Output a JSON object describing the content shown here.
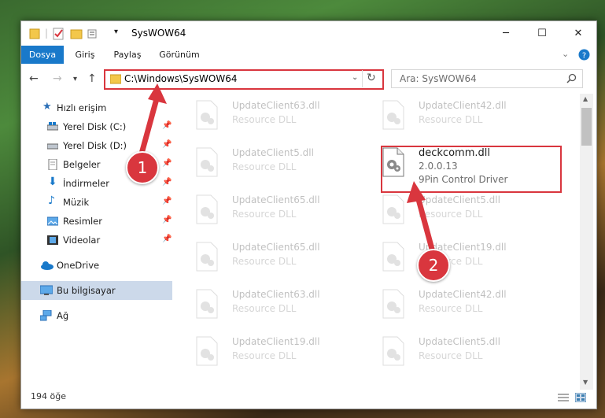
{
  "window": {
    "title": "SysWOW64",
    "controls": {
      "minimize": "─",
      "maximize": "☐",
      "close": "✕"
    }
  },
  "ribbon": {
    "tabs": [
      {
        "label": "Dosya",
        "active": true
      },
      {
        "label": "Giriş",
        "active": false
      },
      {
        "label": "Paylaş",
        "active": false
      },
      {
        "label": "Görünüm",
        "active": false
      }
    ],
    "collapse_icon": "chevron-down-icon",
    "help_icon": "help-icon"
  },
  "nav": {
    "address": "C:\\Windows\\SysWOW64",
    "search_placeholder": "Ara: SysWOW64"
  },
  "sidebar": {
    "items": [
      {
        "label": "Hızlı erişim",
        "icon": "star-icon",
        "pinned": false
      },
      {
        "label": "Yerel Disk (C:)",
        "icon": "drive-icon",
        "pinned": true
      },
      {
        "label": "Yerel Disk (D:)",
        "icon": "drive-icon",
        "pinned": true
      },
      {
        "label": "Belgeler",
        "icon": "documents-icon",
        "pinned": true
      },
      {
        "label": "İndirmeler",
        "icon": "download-icon",
        "pinned": true
      },
      {
        "label": "Müzik",
        "icon": "music-icon",
        "pinned": true
      },
      {
        "label": "Resimler",
        "icon": "pictures-icon",
        "pinned": true
      },
      {
        "label": "Videolar",
        "icon": "videos-icon",
        "pinned": true
      },
      {
        "label": "OneDrive",
        "icon": "cloud-icon",
        "pinned": false
      },
      {
        "label": "Bu bilgisayar",
        "icon": "computer-icon",
        "pinned": false,
        "selected": true
      },
      {
        "label": "Ağ",
        "icon": "network-icon",
        "pinned": false
      }
    ]
  },
  "files": [
    {
      "name": "UpdateClient63.dll",
      "type": "Resource DLL"
    },
    {
      "name": "UpdateClient42.dll",
      "type": "Resource DLL"
    },
    {
      "name": "UpdateClient5.dll",
      "type": "Resource DLL"
    },
    {
      "name": "deckcomm.dll",
      "version": "2.0.0.13",
      "type": "9Pin Control Driver",
      "highlighted": true
    },
    {
      "name": "UpdateClient65.dll",
      "type": "Resource DLL"
    },
    {
      "name": "UpdateClient5.dll",
      "type": "Resource DLL"
    },
    {
      "name": "UpdateClient65.dll",
      "type": "Resource DLL"
    },
    {
      "name": "UpdateClient19.dll",
      "type": "Resource DLL"
    },
    {
      "name": "UpdateClient63.dll",
      "type": "Resource DLL"
    },
    {
      "name": "UpdateClient42.dll",
      "type": "Resource DLL"
    },
    {
      "name": "UpdateClient19.dll",
      "type": "Resource DLL"
    },
    {
      "name": "UpdateClient5.dll",
      "type": "Resource DLL"
    }
  ],
  "status": {
    "item_count": "194 öğe"
  },
  "annotations": {
    "step1": "1",
    "step2": "2",
    "accent": "#d9363e"
  }
}
